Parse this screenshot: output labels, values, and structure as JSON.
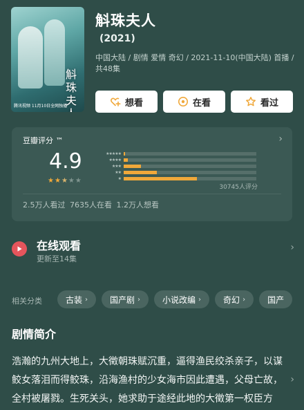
{
  "header": {
    "title": "斛珠夫人",
    "year": "(2021)",
    "meta": "中国大陆 / 剧情 爱情 奇幻 / 2021-11-10(中国大陆) 首播 / 共48集",
    "poster": {
      "title": "斛珠夫人",
      "footer": "腾讯视频 11月10日全网独播"
    },
    "actions": [
      {
        "label": "想看",
        "icon": "heart-plus-icon"
      },
      {
        "label": "在看",
        "icon": "play-circle-icon"
      },
      {
        "label": "看过",
        "icon": "star-icon"
      }
    ]
  },
  "rating": {
    "label": "豆瓣评分 ™",
    "score": "4.9",
    "stars": 2.5,
    "distribution_percent": [
      1,
      3,
      13,
      25,
      55
    ],
    "distribution_levels": [
      "★★★★★",
      "★★★★",
      "★★★",
      "★★",
      "★"
    ],
    "votes": "30745人评分",
    "summary": "2.5万人看过  7635人在看  1.2万人想看"
  },
  "watch": {
    "title": "在线观看",
    "subtitle": "更新至14集"
  },
  "tags": {
    "label": "相关分类",
    "items": [
      "古装",
      "国产剧",
      "小说改编",
      "奇幻",
      "国产"
    ]
  },
  "synopsis": {
    "title": "剧情简介",
    "text": "浩瀚的九州大地上，大徵朝珠赋沉重，逼得渔民绞杀亲子，以谋鲛女落泪而得鲛珠，沿海渔村的少女海市因此遭遇，父母亡故，全村被屠戮。生死关头，她求助于途经此地的大徵第一权臣方诸，历经考验，最终被方诸..."
  },
  "colors": {
    "background": "#2f4d48",
    "card": "#3b5954",
    "accent_star": "#f1a93a",
    "watch_icon": "#e5555c"
  }
}
